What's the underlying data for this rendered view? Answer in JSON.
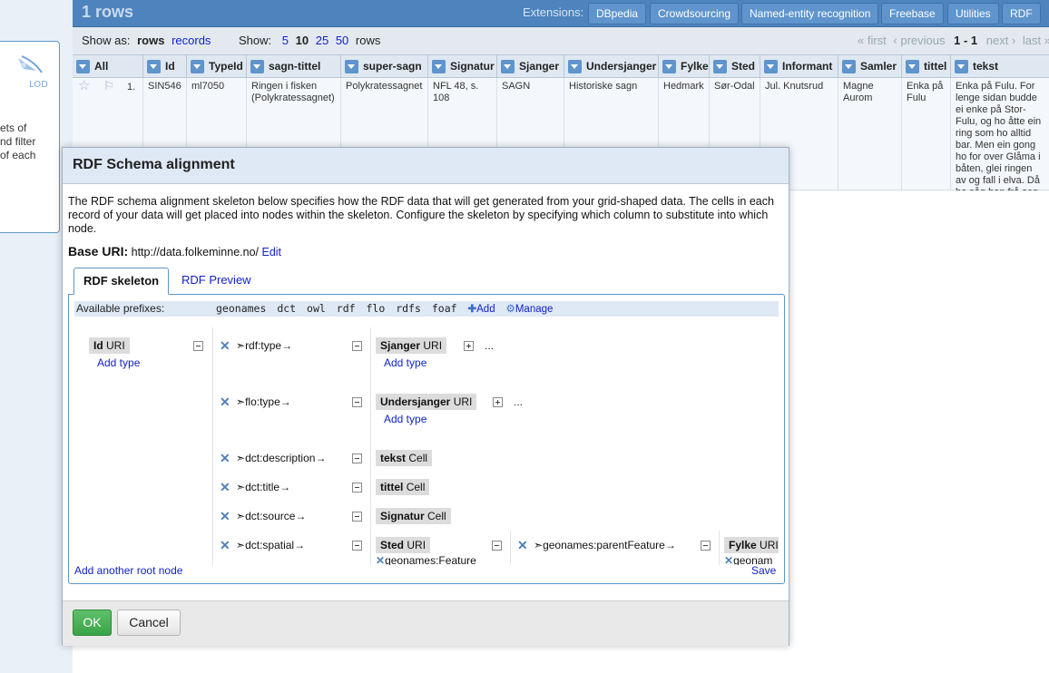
{
  "left_panel": {
    "logo_text": "LOD",
    "text_lines": [
      "ets of",
      "nd filter",
      "of each"
    ]
  },
  "header": {
    "rows_count": "1 rows",
    "extensions_label": "Extensions:",
    "extensions": [
      "DBpedia",
      "Crowdsourcing",
      "Named-entity recognition",
      "Freebase",
      "Utilities",
      "RDF"
    ]
  },
  "viewbar": {
    "show_as_label": "Show as:",
    "mode_rows": "rows",
    "mode_records": "records",
    "show_label": "Show:",
    "page_sizes": [
      "5",
      "10",
      "25",
      "50"
    ],
    "rows_suffix": "rows",
    "pager_first": "« first",
    "pager_previous": "‹ previous",
    "pager_range": "1 - 1",
    "pager_next": "next ›",
    "pager_last": "last »"
  },
  "grid": {
    "columns": [
      "All",
      "Id",
      "TypeId",
      "sagn-tittel",
      "super-sagn",
      "Signatur",
      "Sjanger",
      "Undersjanger",
      "Fylke",
      "Sted",
      "Informant",
      "Samler",
      "tittel",
      "tekst"
    ],
    "row": {
      "index": "1.",
      "cells": [
        "SIN546",
        "ml7050",
        "Ringen i fisken (Polykratessagnet)",
        "Polykratessagnet",
        "NFL 48, s. 108",
        "SAGN",
        "Historiske sagn",
        "Hedmark",
        "Sør-Odal",
        "Jul. Knutsrud",
        "Magne Aurom",
        "Enka på Fulu"
      ],
      "tekst": "Enka på Fulu. For lenge sidan budde ei enke på Stor-Fulu, og ho åtte ein ring som ho alltid bar. Men ein gong ho for over Glåma i båten, glei ringen av og fall i elva. Då ho såg han frå seg med de orda: «Nei, no ser eg han aldri meir. Eg er så fattig som at jeg kan ikkje få han att.» Men ei tid etterpå. Ein mann fekk ein stor fisk, og då han skar han opp, fann han ein fingerring. Det var enka sin ring. Nesten akkurat same dag. Ellingsrud - og like ei"
    }
  },
  "dialog": {
    "title": "RDF Schema alignment",
    "description": "The RDF schema alignment skeleton below specifies how the RDF data that will get generated from your grid-shaped data. The cells in each record of your data will get placed into nodes within the skeleton. Configure the skeleton by specifying which column to substitute into which node.",
    "base_uri_label": "Base URI:",
    "base_uri": "http://data.folkeminne.no/",
    "edit_label": "Edit",
    "tabs": [
      "RDF skeleton",
      "RDF Preview"
    ],
    "prefixes_label": "Available prefixes:",
    "prefixes": [
      "geonames",
      "dct",
      "owl",
      "rdf",
      "flo",
      "rdfs",
      "foaf"
    ],
    "add_label": "Add",
    "manage_label": "Manage",
    "root_node": {
      "name": "Id",
      "kind": "URI",
      "add_type": "Add type"
    },
    "properties": [
      {
        "name": "rdf:type",
        "target_name": "Sjanger",
        "target_kind": "URI",
        "add_type": "Add type",
        "expandable": true
      },
      {
        "name": "flo:type",
        "target_name": "Undersjanger",
        "target_kind": "URI",
        "add_type": "Add type",
        "expandable": true
      },
      {
        "name": "dct:description",
        "target_name": "tekst",
        "target_kind": "Cell"
      },
      {
        "name": "dct:title",
        "target_name": "tittel",
        "target_kind": "Cell"
      },
      {
        "name": "dct:source",
        "target_name": "Signatur",
        "target_kind": "Cell"
      },
      {
        "name": "dct:spatial",
        "target_name": "Sted",
        "target_kind": "URI",
        "type_label": "geonames:Feature"
      }
    ],
    "sub_property": {
      "name": "geonames:parentFeature",
      "target_name": "Fylke",
      "target_kind": "URI",
      "type_label": "geonam"
    },
    "add_root_label": "Add another root node",
    "save_label": "Save",
    "ok_label": "OK",
    "cancel_label": "Cancel"
  },
  "colors": {
    "header_blue": "#4d84bd",
    "link_blue": "#1122cc",
    "ok_green": "#3aa348",
    "dialog_title_bg": "#dfe9f5"
  }
}
